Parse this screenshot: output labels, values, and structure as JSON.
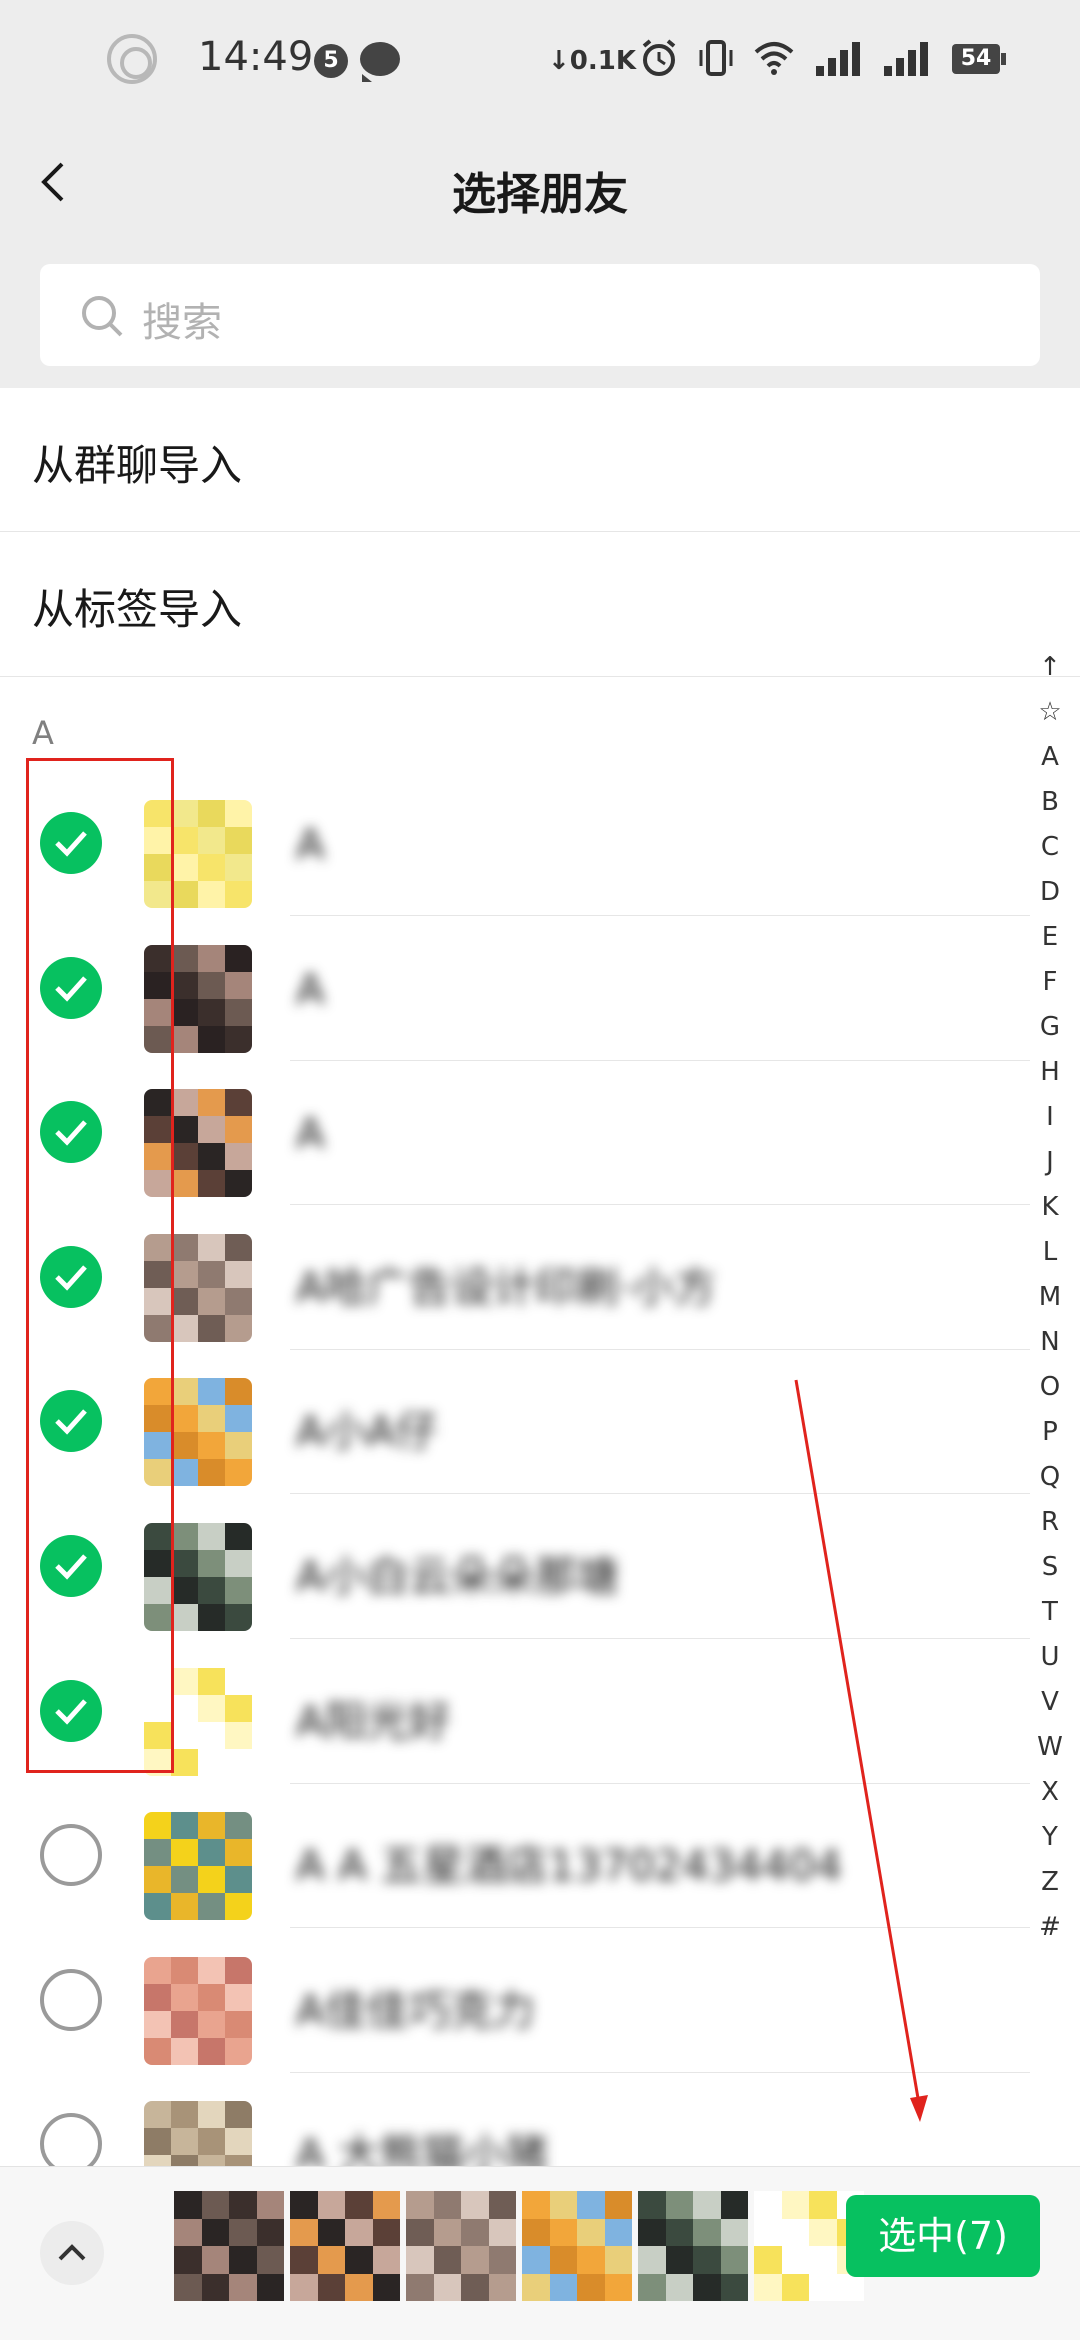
{
  "status_bar": {
    "time": "14:49",
    "notification_count": "5",
    "net_speed": "↓0.1K",
    "battery": "54",
    "icons": [
      "ring-icon",
      "chat-bubble-icon",
      "alarm-icon",
      "vibrate-icon",
      "wifi-icon",
      "signal-icon",
      "signal-2-icon",
      "battery-icon"
    ]
  },
  "nav": {
    "title": "选择朋友",
    "back_icon": "chevron-left-icon"
  },
  "search": {
    "placeholder": "搜索",
    "icon": "search-icon"
  },
  "imports": [
    {
      "label": "从群聊导入"
    },
    {
      "label": "从标签导入"
    }
  ],
  "section": {
    "letter": "A"
  },
  "contacts": [
    {
      "name": "A",
      "checked": true,
      "palette": [
        "#f7e46a",
        "#f2e88c",
        "#e9d95c",
        "#fff3a8"
      ]
    },
    {
      "name": "A",
      "checked": true,
      "palette": [
        "#3b2f2c",
        "#6c5a52",
        "#a5857a",
        "#2a2222"
      ]
    },
    {
      "name": "A",
      "checked": true,
      "palette": [
        "#2a2524",
        "#c7a79a",
        "#e49a4d",
        "#5b4037"
      ]
    },
    {
      "name": "A哈广告设计印刷·小方",
      "checked": true,
      "palette": [
        "#b59c8e",
        "#8f7a70",
        "#d8c6bc",
        "#6f5d55"
      ]
    },
    {
      "name": "A小A仔",
      "checked": true,
      "palette": [
        "#f2a63a",
        "#e9cf7a",
        "#7fb3e0",
        "#d98c2a"
      ]
    },
    {
      "name": "A小白云朵朵那塘",
      "checked": true,
      "palette": [
        "#3b4a3f",
        "#7d8f7a",
        "#c8cfc5",
        "#262b28"
      ]
    },
    {
      "name": "A阳光好",
      "checked": true,
      "palette": [
        "#ffffff",
        "#fff7c2",
        "#f7e25b",
        "#ffffff"
      ]
    },
    {
      "name": "A A 五星酒店13702434404",
      "checked": false,
      "palette": [
        "#f4d21b",
        "#5d8f8c",
        "#e9b62a",
        "#748f82"
      ]
    },
    {
      "name": "A佳佳巧克力",
      "checked": false,
      "palette": [
        "#e9a48f",
        "#d98a74",
        "#f3c3b4",
        "#c7766a"
      ]
    },
    {
      "name": "A 大熊猫小猪",
      "checked": false,
      "palette": [
        "#c7b59a",
        "#a89378",
        "#e3d6bd",
        "#8e7c66"
      ]
    }
  ],
  "index_bar": [
    "↑",
    "☆",
    "A",
    "B",
    "C",
    "D",
    "E",
    "F",
    "G",
    "H",
    "I",
    "J",
    "K",
    "L",
    "M",
    "N",
    "O",
    "P",
    "Q",
    "R",
    "S",
    "T",
    "U",
    "V",
    "W",
    "X",
    "Y",
    "Z",
    "#"
  ],
  "bottom": {
    "expand_icon": "chevron-up-icon",
    "confirm_label": "选中(7)",
    "selected_palettes": [
      [
        "#2a2524",
        "#6c5a52",
        "#3b2f2c",
        "#a5857a"
      ],
      [
        "#2a2524",
        "#c7a79a",
        "#5b4037",
        "#e49a4d"
      ],
      [
        "#b59c8e",
        "#8f7a70",
        "#d8c6bc",
        "#6f5d55"
      ],
      [
        "#f2a63a",
        "#e9cf7a",
        "#7fb3e0",
        "#d98c2a"
      ],
      [
        "#3b4a3f",
        "#7d8f7a",
        "#c8cfc5",
        "#262b28"
      ],
      [
        "#ffffff",
        "#fff7c2",
        "#f7e25b",
        "#ffffff"
      ]
    ]
  },
  "colors": {
    "accent": "#07c160",
    "background": "#ededed",
    "annotation": "#e0231d"
  }
}
